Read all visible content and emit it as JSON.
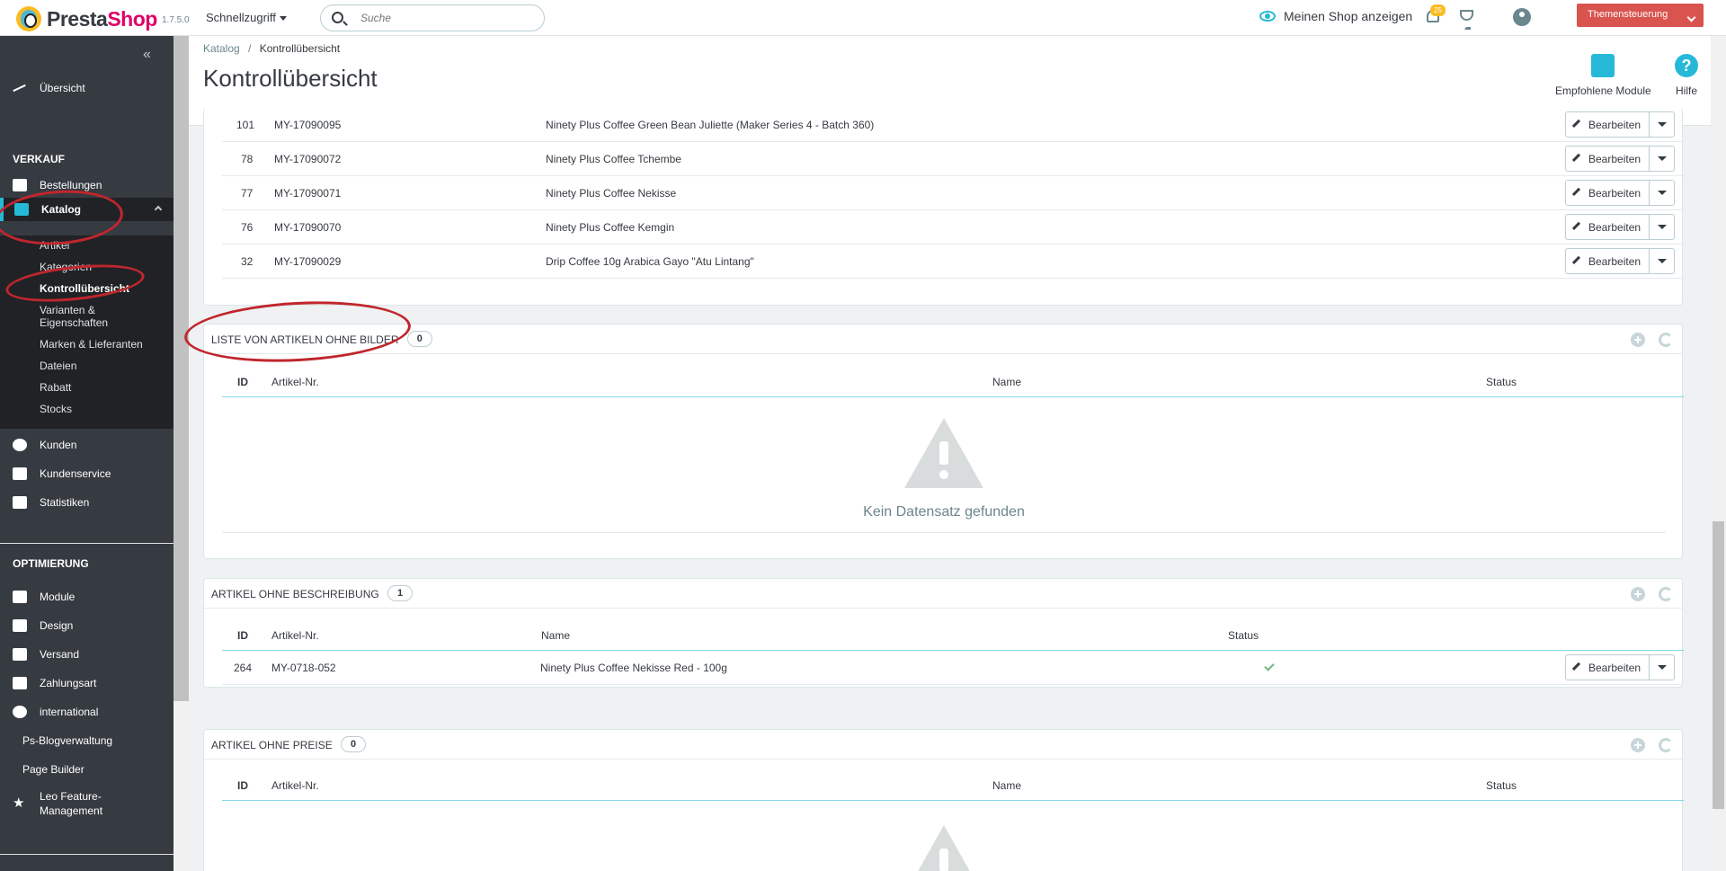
{
  "header": {
    "brand_presta": "Presta",
    "brand_shop": "Shop",
    "version": "1.7.5.0",
    "quick_access": "Schnellzugriff",
    "search_placeholder": "Suche",
    "view_shop": "Meinen Shop anzeigen",
    "notifications_count": "25",
    "theme_button": "Themensteuerung"
  },
  "sidebar": {
    "collapse": "«",
    "overview": "Übersicht",
    "section_sell": "VERKAUF",
    "orders": "Bestellungen",
    "catalog": "Katalog",
    "catalog_sub": [
      "Artikel",
      "Kategorien",
      "Kontrollübersicht",
      "Varianten &\nEigenschaften",
      "Marken & Lieferanten",
      "Dateien",
      "Rabatt",
      "Stocks"
    ],
    "customers": "Kunden",
    "customer_service": "Kundenservice",
    "statistics": "Statistiken",
    "section_improve": "OPTIMIERUNG",
    "modules": "Module",
    "design": "Design",
    "shipping": "Versand",
    "payment": "Zahlungsart",
    "international": "international",
    "blog": "Ps-Blogverwaltung",
    "page_builder": "Page Builder",
    "leo_feature": "Leo Feature-\nManagement"
  },
  "page": {
    "breadcrumb_parent": "Katalog",
    "breadcrumb_sep": "/",
    "breadcrumb_current": "Kontrollübersicht",
    "title": "Kontrollübersicht",
    "recommended_modules": "Empfohlene Module",
    "help": "Hilfe"
  },
  "top_table": {
    "edit_label": "Bearbeiten",
    "rows": [
      {
        "id": "101",
        "ref": "MY-17090095",
        "name": "Ninety Plus Coffee Green Bean Juliette (Maker Series 4 - Batch 360)"
      },
      {
        "id": "78",
        "ref": "MY-17090072",
        "name": "Ninety Plus Coffee Tchembe"
      },
      {
        "id": "77",
        "ref": "MY-17090071",
        "name": "Ninety Plus Coffee Nekisse"
      },
      {
        "id": "76",
        "ref": "MY-17090070",
        "name": "Ninety Plus Coffee Kemgin"
      },
      {
        "id": "32",
        "ref": "MY-17090029",
        "name": "Drip Coffee 10g Arabica Gayo \"Atu Lintang\""
      }
    ]
  },
  "no_images": {
    "title": "LISTE VON ARTIKELN OHNE BILDER",
    "count": "0",
    "columns": [
      "ID",
      "Artikel-Nr.",
      "Name",
      "Status"
    ],
    "empty_text": "Kein Datensatz gefunden"
  },
  "no_description": {
    "title": "ARTIKEL OHNE BESCHREIBUNG",
    "count": "1",
    "columns": [
      "ID",
      "Artikel-Nr.",
      "Name",
      "Status"
    ],
    "rows": [
      {
        "id": "264",
        "ref": "MY-0718-052",
        "name": "Ninety Plus Coffee Nekisse Red - 100g",
        "edit": "Bearbeiten"
      }
    ]
  },
  "no_price": {
    "title": "ARTIKEL OHNE PREISE",
    "count": "0",
    "columns": [
      "ID",
      "Artikel-Nr.",
      "Name",
      "Status"
    ]
  },
  "colors": {
    "accent": "#25b9d7",
    "sidebar": "#363a41",
    "theme_button": "#d9534f",
    "annotation": "#c0262d"
  }
}
